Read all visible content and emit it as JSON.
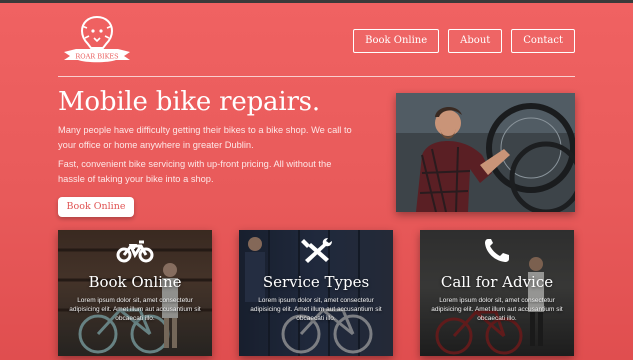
{
  "brand": {
    "logo_text": "ROAR BIKES",
    "accent_color": "#e95c5c"
  },
  "nav": {
    "items": [
      {
        "label": "Book Online"
      },
      {
        "label": "About"
      },
      {
        "label": "Contact"
      }
    ]
  },
  "hero": {
    "title": "Mobile bike repairs.",
    "paragraph1": "Many people have difficulty getting their bikes to a bike shop. We call to your office or home anywhere in greater Dublin.",
    "paragraph2": "Fast, convenient bike servicing with up-front pricing. All without the hassle of taking your bike into a shop.",
    "cta_label": "Book Online",
    "photo_desc": "mechanic-repairing-bike-photo"
  },
  "cards": [
    {
      "title": "Book Online",
      "icon": "motorcycle-icon",
      "text": "Lorem ipsum dolor sit, amet consectetur adipisicing elit. Amet illum aut accusantium sit obcaecati illo."
    },
    {
      "title": "Service Types",
      "icon": "tools-icon",
      "text": "Lorem ipsum dolor sit, amet consectetur adipisicing elit. Amet illum aut accusantium sit obcaecati illo."
    },
    {
      "title": "Call for Advice",
      "icon": "phone-icon",
      "text": "Lorem ipsum dolor sit, amet consectetur adipisicing elit. Amet illum aut accusantium sit obcaecati illo."
    }
  ]
}
